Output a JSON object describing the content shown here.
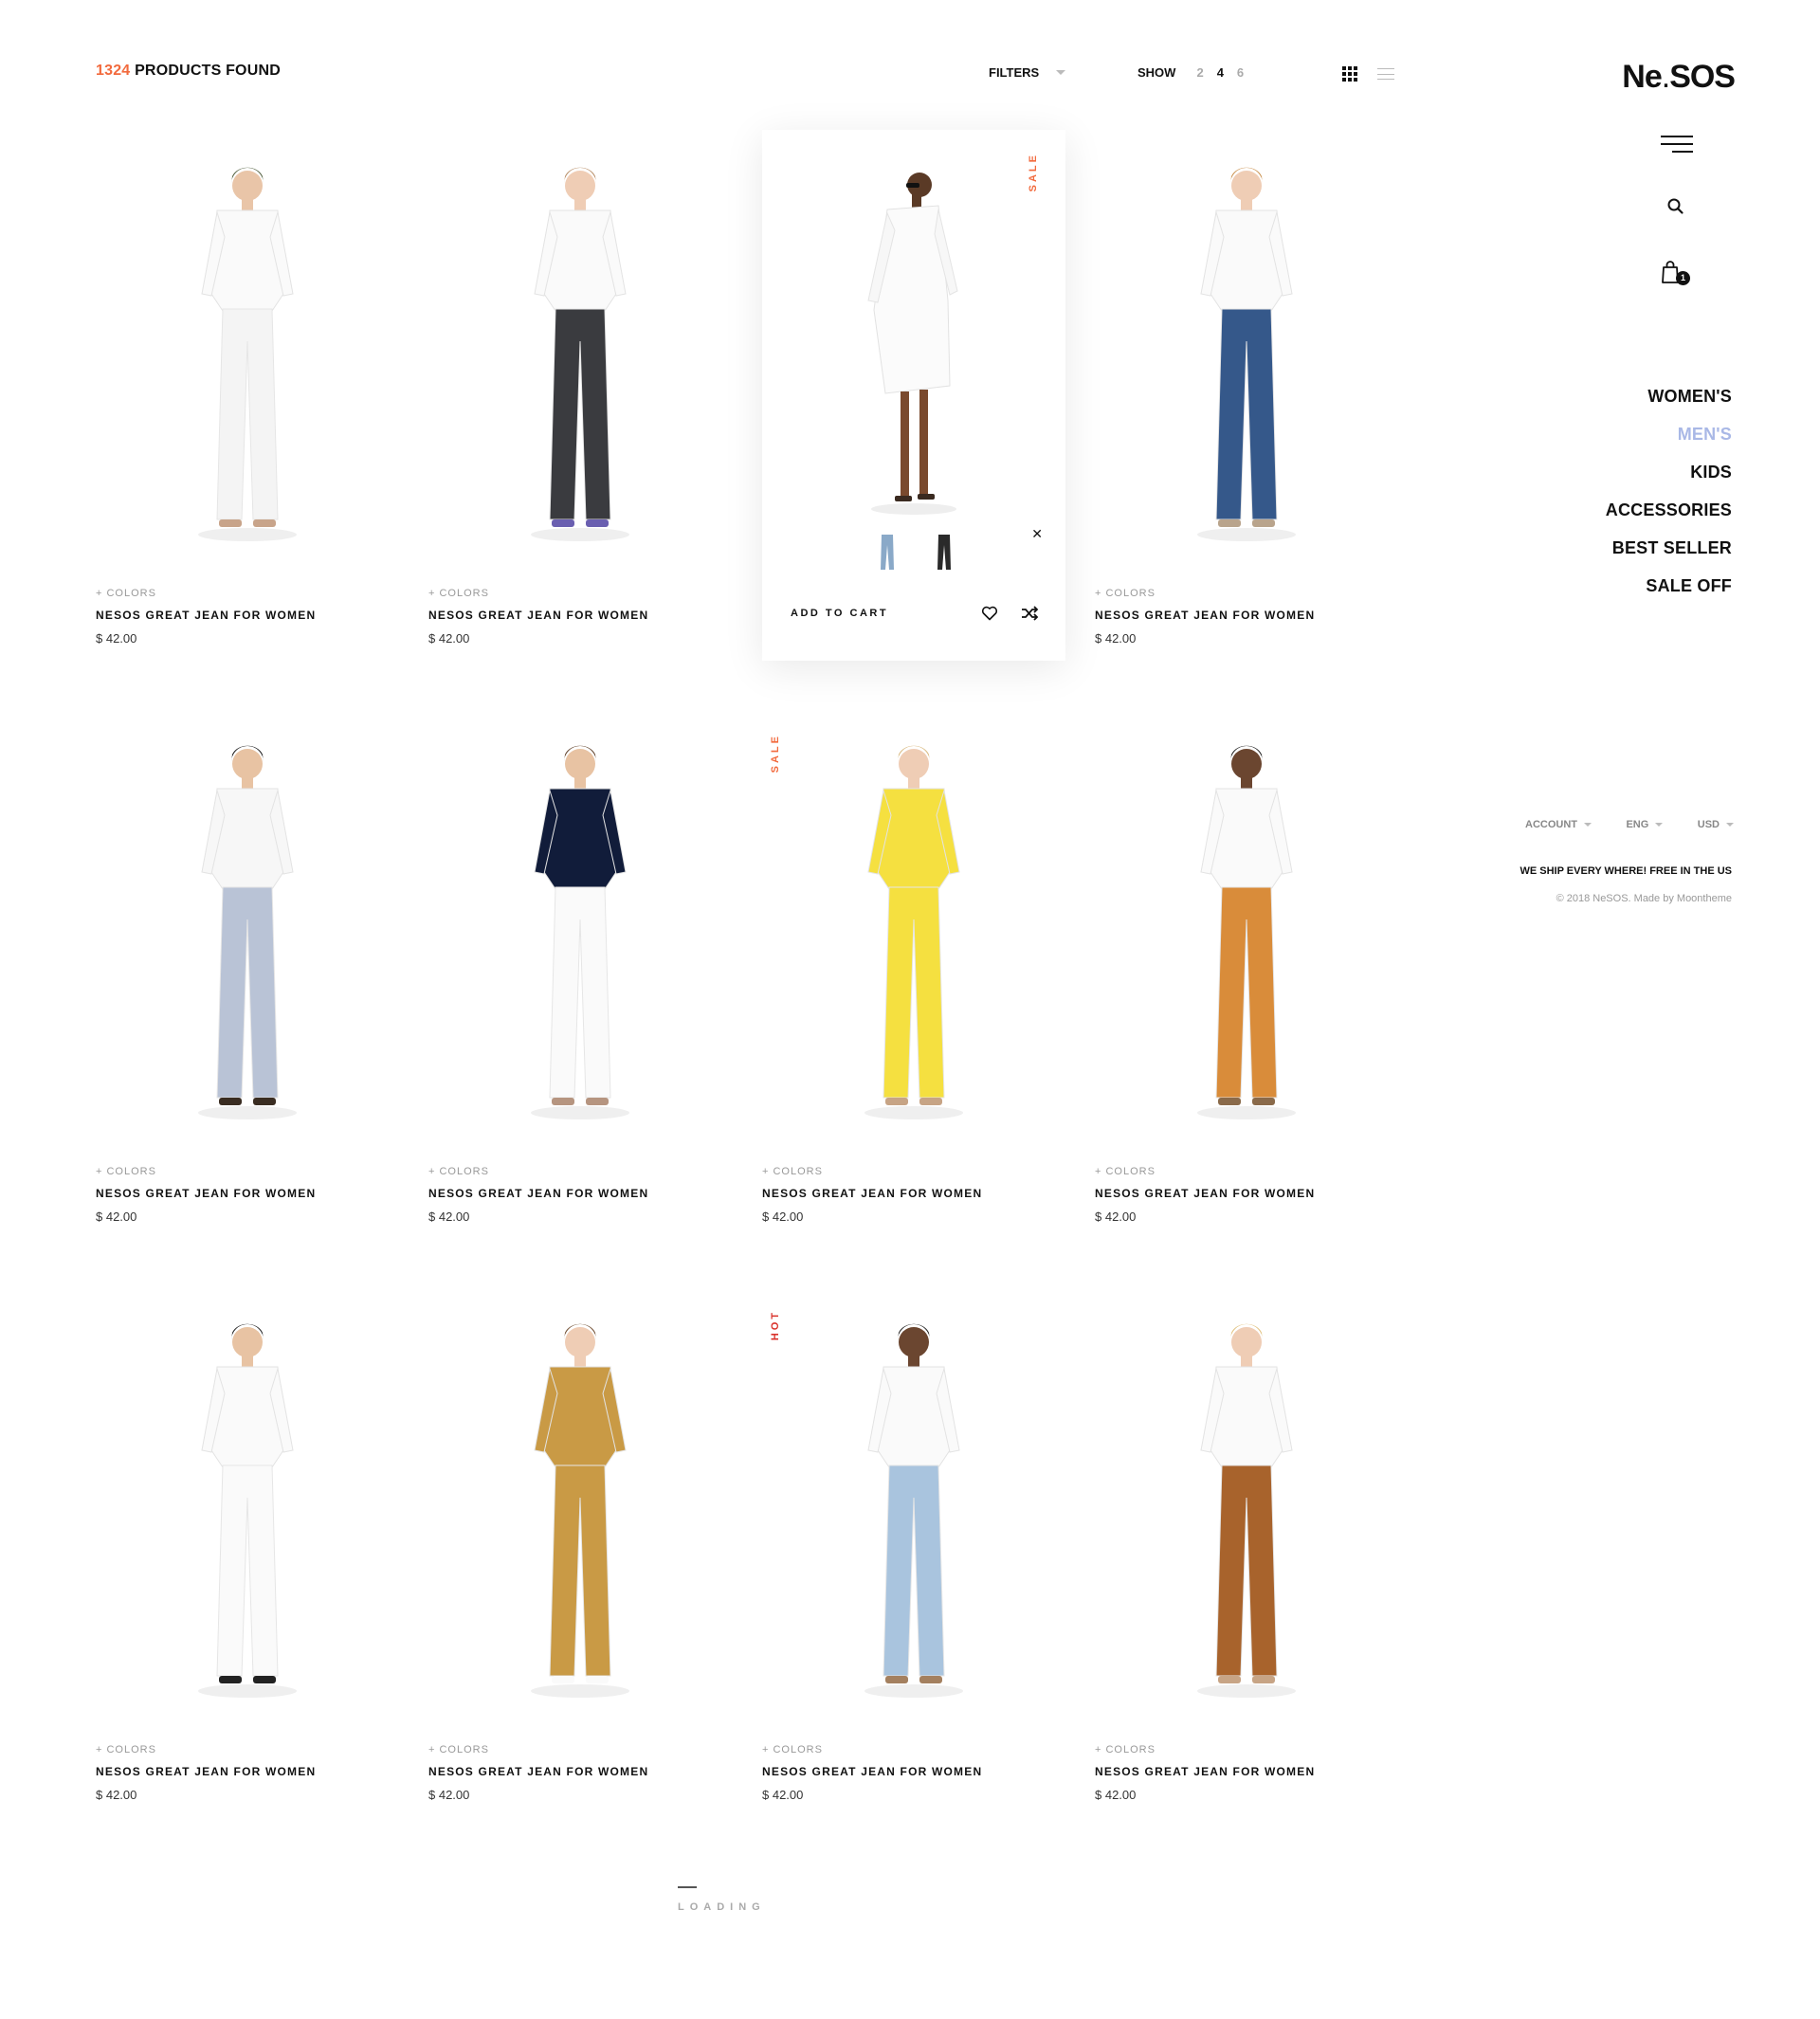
{
  "header": {
    "products_count": "1324",
    "products_label": "PRODUCTS FOUND",
    "filters_label": "FILTERS",
    "show_label": "SHOW",
    "show_options": [
      "2",
      "4",
      "6"
    ],
    "show_selected": "4"
  },
  "brand": {
    "logo_main": "Ne",
    "logo_dot": ".",
    "logo_end": "SOS"
  },
  "cart": {
    "count": "1"
  },
  "nav": [
    {
      "label": "WOMEN'S"
    },
    {
      "label": "MEN'S",
      "active": true
    },
    {
      "label": "KIDS"
    },
    {
      "label": "ACCESSORIES"
    },
    {
      "label": "BEST SELLER"
    },
    {
      "label": "SALE OFF"
    }
  ],
  "footer": {
    "account_label": "ACCOUNT",
    "language_label": "ENG",
    "currency_label": "USD",
    "shipping_note": "WE SHIP EVERY WHERE! FREE IN THE US",
    "copyright": "© 2018 NeSOS.  Made by Moontheme"
  },
  "hover_card": {
    "add_to_cart_label": "ADD TO CART",
    "badge": "SALE"
  },
  "products": [
    {
      "colors": "+ COLORS",
      "name": "NESOS GREAT JEAN FOR WOMEN",
      "price": "$ 42.00",
      "badge": ""
    },
    {
      "colors": "+ COLORS",
      "name": "NESOS GREAT JEAN FOR WOMEN",
      "price": "$ 42.00",
      "badge": ""
    },
    {
      "colors": "",
      "name": "",
      "price": "",
      "badge": "SALE"
    },
    {
      "colors": "+ COLORS",
      "name": "NESOS GREAT JEAN FOR WOMEN",
      "price": "$ 42.00",
      "badge": ""
    },
    {
      "colors": "+ COLORS",
      "name": "NESOS GREAT JEAN FOR WOMEN",
      "price": "$ 42.00",
      "badge": ""
    },
    {
      "colors": "+ COLORS",
      "name": "NESOS GREAT JEAN FOR WOMEN",
      "price": "$ 42.00",
      "badge": "SALE"
    },
    {
      "colors": "+ COLORS",
      "name": "NESOS GREAT JEAN FOR WOMEN",
      "price": "$ 42.00",
      "badge": ""
    },
    {
      "colors": "+ COLORS",
      "name": "NESOS GREAT JEAN FOR WOMEN",
      "price": "$ 42.00",
      "badge": ""
    },
    {
      "colors": "+ COLORS",
      "name": "NESOS GREAT JEAN FOR WOMEN",
      "price": "$ 42.00",
      "badge": ""
    },
    {
      "colors": "+ COLORS",
      "name": "NESOS GREAT JEAN FOR WOMEN",
      "price": "$ 42.00",
      "badge": "HOT"
    },
    {
      "colors": "+ COLORS",
      "name": "NESOS GREAT JEAN FOR WOMEN",
      "price": "$ 42.00",
      "badge": ""
    },
    {
      "colors": "+ COLORS",
      "name": "NESOS GREAT JEAN FOR WOMEN",
      "price": "$ 42.00",
      "badge": ""
    }
  ],
  "loading_label": "LOADING",
  "colors": {
    "accent": "#f26a3d",
    "hot": "#d9322b",
    "nav_active": "#a9b8e6",
    "text": "#111111"
  }
}
